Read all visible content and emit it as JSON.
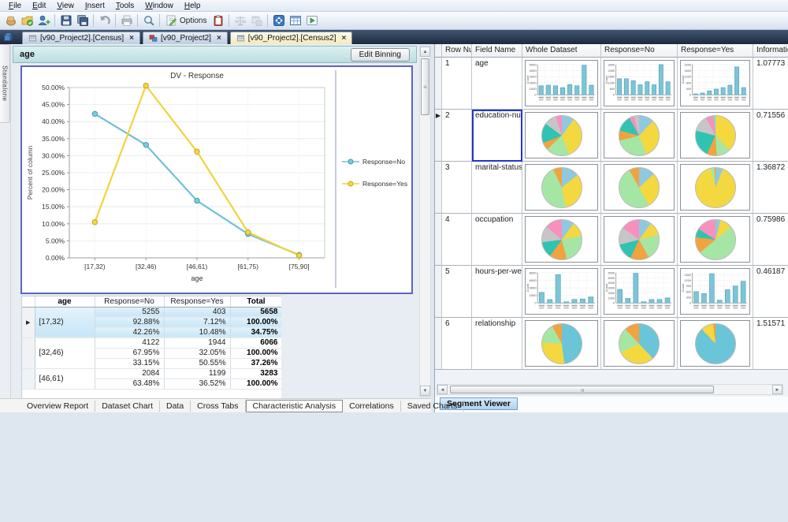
{
  "menu": {
    "items": [
      "File",
      "Edit",
      "View",
      "Insert",
      "Tools",
      "Window",
      "Help"
    ]
  },
  "toolbar": {
    "options_label": "Options",
    "groups": [
      [
        "grab-hand-icon",
        "open-project-icon",
        "add-user-icon"
      ],
      [
        "save-icon",
        "save-all-icon"
      ],
      [
        "undo-icon"
      ],
      [
        "print-icon"
      ],
      [
        "preview-icon"
      ],
      [
        "options-icon",
        "@label",
        "report-icon"
      ],
      [
        "compare-icon",
        "window-save-icon"
      ],
      [
        "expand-icon",
        "data-grid-icon",
        "run-icon"
      ]
    ]
  },
  "doc_tabs": [
    {
      "label": "[v90_Project2].[Census]",
      "icon": "grid-doc-icon",
      "close": "×",
      "active": false
    },
    {
      "label": "[v90_Project2]",
      "icon": "workspace-icon",
      "close": "×",
      "active": false
    },
    {
      "label": "[v90_Project2].[Census2]",
      "icon": "grid-doc-icon",
      "close": "×",
      "active": true
    }
  ],
  "side_strip": {
    "label": "Standalone"
  },
  "left_panel": {
    "field_label": "age",
    "edit_binning_label": "Edit Binning",
    "chart_data": {
      "type": "line",
      "title": "DV - Response",
      "xlabel": "age",
      "ylabel": "Percent of column",
      "categories": [
        "[17,32)",
        "[32,46)",
        "[46,61)",
        "[61,75)",
        "[75,90]"
      ],
      "series": [
        {
          "name": "Response=No",
          "color": "#6FC2D6",
          "marker": "#7ECBDC",
          "edge": "#3E9BB4",
          "values": [
            42.26,
            33.15,
            16.76,
            7.0,
            0.85
          ]
        },
        {
          "name": "Response=Yes",
          "color": "#F2D33C",
          "marker": "#F4D83F",
          "edge": "#C9A41E",
          "values": [
            10.48,
            50.55,
            31.18,
            7.5,
            0.7
          ]
        }
      ],
      "ylim": [
        0,
        50
      ],
      "ytick_step": 5,
      "legend_position": "right",
      "grid": true
    },
    "crosstab": {
      "headers": [
        "age",
        "Response=No",
        "Response=Yes",
        "Total"
      ],
      "groups": [
        {
          "bin": "[17,32)",
          "selected": true,
          "current": true,
          "rows": [
            [
              "5255",
              "403",
              "5658"
            ],
            [
              "92.88%",
              "7.12%",
              "100.00%"
            ],
            [
              "42.26%",
              "10.48%",
              "34.75%"
            ]
          ]
        },
        {
          "bin": "[32,46)",
          "selected": false,
          "current": false,
          "rows": [
            [
              "4122",
              "1944",
              "6066"
            ],
            [
              "67.95%",
              "32.05%",
              "100.00%"
            ],
            [
              "33.15%",
              "50.55%",
              "37.26%"
            ]
          ]
        },
        {
          "bin": "[46,61)",
          "selected": false,
          "current": false,
          "rows": [
            [
              "2084",
              "1199",
              "3283"
            ],
            [
              "63.48%",
              "36.52%",
              "100.00%"
            ]
          ]
        }
      ]
    },
    "bottom_tabs": {
      "items": [
        {
          "label": "Overview Report",
          "active": false
        },
        {
          "label": "Dataset Chart",
          "active": false
        },
        {
          "label": "Data",
          "active": false
        },
        {
          "label": "Cross Tabs",
          "active": false
        },
        {
          "label": "Characteristic Analysis",
          "active": true
        },
        {
          "label": "Correlations",
          "active": false
        },
        {
          "label": "Saved Charts",
          "active": false
        }
      ]
    }
  },
  "segment_viewer": {
    "tab_label": "Segment Viewer",
    "columns": [
      "",
      "Row Num",
      "Field Name",
      "Whole Dataset",
      "Response=No",
      "Response=Yes",
      "Information"
    ],
    "palette": {
      "yellow": "#F4D83F",
      "teal": "#31C3B2",
      "green": "#A5E6A5",
      "pink": "#F890BE",
      "gray": "#C6C6C6",
      "orange": "#F1A33F",
      "blue": "#90C8E0",
      "cyan": "#6AC5D8"
    },
    "bar_color": "#7CC5D6",
    "count_label": "Count",
    "rows": [
      {
        "num": "1",
        "field": "age",
        "info": "1.07773",
        "current": false,
        "selected": false,
        "charts": [
          {
            "type": "bar",
            "ymax": 5000,
            "yticks": [
              0,
              1000,
              2000,
              3000,
              4000,
              5000
            ],
            "values": [
              1500,
              1600,
              1500,
              1200,
              1700,
              1500,
              4900,
              1600
            ]
          },
          {
            "type": "bar",
            "ymax": 3000,
            "yticks": [
              0,
              600,
              1200,
              1800,
              2400,
              3000
            ],
            "values": [
              1600,
              1600,
              1400,
              1000,
              1300,
              1000,
              3000,
              1300
            ]
          },
          {
            "type": "bar",
            "ymax": 2000,
            "yticks": [
              0,
              400,
              800,
              1200,
              1600,
              2000
            ],
            "values": [
              60,
              120,
              260,
              380,
              480,
              640,
              1850,
              480
            ]
          }
        ]
      },
      {
        "num": "2",
        "field": "education-num",
        "info": "0.71556",
        "current": true,
        "selected": true,
        "charts": [
          {
            "type": "pie",
            "slices": [
              [
                "blue",
                10
              ],
              [
                "yellow",
                34
              ],
              [
                "green",
                19
              ],
              [
                "orange",
                6
              ],
              [
                "teal",
                16
              ],
              [
                "gray",
                10
              ],
              [
                "pink",
                5
              ]
            ]
          },
          {
            "type": "pie",
            "slices": [
              [
                "blue",
                12
              ],
              [
                "yellow",
                32
              ],
              [
                "green",
                27
              ],
              [
                "orange",
                8
              ],
              [
                "teal",
                13
              ],
              [
                "pink",
                4
              ],
              [
                "gray",
                4
              ]
            ]
          },
          {
            "type": "pie",
            "slices": [
              [
                "yellow",
                38
              ],
              [
                "green",
                11
              ],
              [
                "orange",
                8
              ],
              [
                "teal",
                22
              ],
              [
                "gray",
                13
              ],
              [
                "pink",
                6
              ],
              [
                "blue",
                2
              ]
            ]
          }
        ]
      },
      {
        "num": "3",
        "field": "marital-status",
        "info": "1.36872",
        "current": false,
        "selected": false,
        "charts": [
          {
            "type": "pie",
            "slices": [
              [
                "blue",
                14
              ],
              [
                "yellow",
                33
              ],
              [
                "green",
                46
              ],
              [
                "orange",
                7
              ]
            ]
          },
          {
            "type": "pie",
            "slices": [
              [
                "blue",
                13
              ],
              [
                "yellow",
                29
              ],
              [
                "green",
                50
              ],
              [
                "orange",
                8
              ]
            ]
          },
          {
            "type": "pie",
            "slices": [
              [
                "blue",
                6
              ],
              [
                "yellow",
                90
              ],
              [
                "green",
                3
              ],
              [
                "orange",
                1
              ]
            ]
          }
        ]
      },
      {
        "num": "4",
        "field": "occupation",
        "info": "0.75986",
        "current": false,
        "selected": false,
        "charts": [
          {
            "type": "pie",
            "slices": [
              [
                "blue",
                10
              ],
              [
                "yellow",
                12
              ],
              [
                "green",
                24
              ],
              [
                "orange",
                14
              ],
              [
                "teal",
                13
              ],
              [
                "gray",
                13
              ],
              [
                "pink",
                14
              ]
            ]
          },
          {
            "type": "pie",
            "slices": [
              [
                "blue",
                10
              ],
              [
                "yellow",
                11
              ],
              [
                "green",
                21
              ],
              [
                "orange",
                15
              ],
              [
                "teal",
                14
              ],
              [
                "gray",
                14
              ],
              [
                "pink",
                15
              ]
            ]
          },
          {
            "type": "pie",
            "slices": [
              [
                "blue",
                4
              ],
              [
                "yellow",
                10
              ],
              [
                "green",
                50
              ],
              [
                "orange",
                13
              ],
              [
                "teal",
                7
              ],
              [
                "pink",
                16
              ]
            ]
          }
        ]
      },
      {
        "num": "5",
        "field": "hours-per-week",
        "info": "0.46187",
        "current": false,
        "selected": false,
        "charts": [
          {
            "type": "bar",
            "ymax": 8000,
            "yticks": [
              0,
              2000,
              4000,
              6000,
              8000
            ],
            "values": [
              2800,
              900,
              7500,
              300,
              950,
              1050,
              1600
            ]
          },
          {
            "type": "bar",
            "ymax": 6000,
            "yticks": [
              0,
              1000,
              2000,
              3000,
              4000,
              5000,
              6000
            ],
            "values": [
              2700,
              900,
              5900,
              250,
              700,
              700,
              1000
            ]
          },
          {
            "type": "bar",
            "ymax": 1600,
            "yticks": [
              0,
              300,
              600,
              900,
              1200,
              1500
            ],
            "values": [
              600,
              500,
              1550,
              150,
              700,
              900,
              1150
            ]
          }
        ]
      },
      {
        "num": "6",
        "field": "relationship",
        "info": "1.51571",
        "current": false,
        "selected": false,
        "charts": [
          {
            "type": "pie",
            "slices": [
              [
                "cyan",
                48
              ],
              [
                "yellow",
                28
              ],
              [
                "green",
                16
              ],
              [
                "orange",
                8
              ]
            ]
          },
          {
            "type": "pie",
            "slices": [
              [
                "cyan",
                38
              ],
              [
                "yellow",
                30
              ],
              [
                "green",
                20
              ],
              [
                "orange",
                12
              ]
            ]
          },
          {
            "type": "pie",
            "slices": [
              [
                "cyan",
                88
              ],
              [
                "yellow",
                10
              ],
              [
                "orange",
                2
              ]
            ]
          }
        ]
      }
    ]
  }
}
